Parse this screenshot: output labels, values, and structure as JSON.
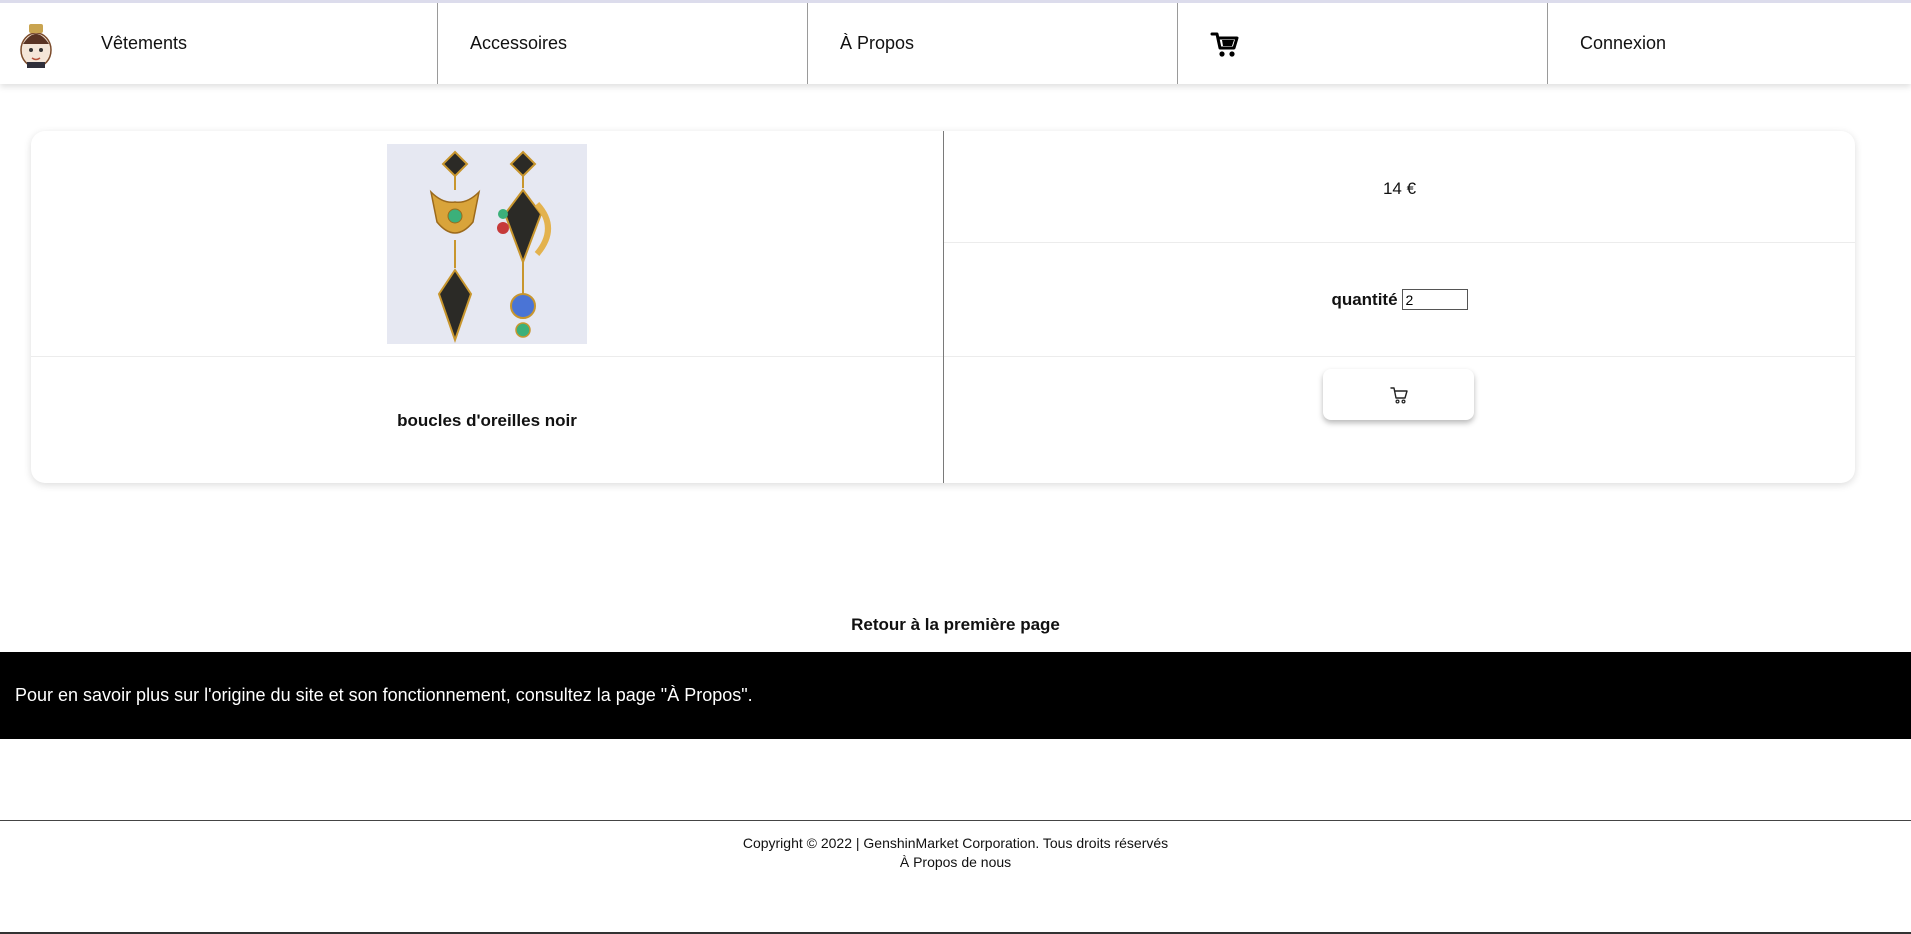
{
  "nav": {
    "items": [
      {
        "label": "Vêtements"
      },
      {
        "label": "Accessoires"
      },
      {
        "label": "À Propos"
      },
      {
        "label": ""
      },
      {
        "label": "Connexion"
      }
    ],
    "cart_icon": "cart-icon",
    "logo_icon": "chibi-character-logo"
  },
  "product": {
    "name": "boucles d'oreilles noir",
    "price": "14 €",
    "quantity_label": "quantité",
    "quantity_value": "2",
    "add_to_cart_icon": "cart-outline-icon"
  },
  "links": {
    "back": "Retour à la première page"
  },
  "banner": {
    "text": "Pour en savoir plus sur l'origine du site et son fonctionnement, consultez la page \"À Propos\"."
  },
  "footer": {
    "copyright": "Copyright © 2022 | GenshinMarket Corporation. Tous droits réservés",
    "about": "À Propos de nous"
  },
  "colors": {
    "banner_bg": "#000000",
    "nav_border": "#dcdcec"
  }
}
